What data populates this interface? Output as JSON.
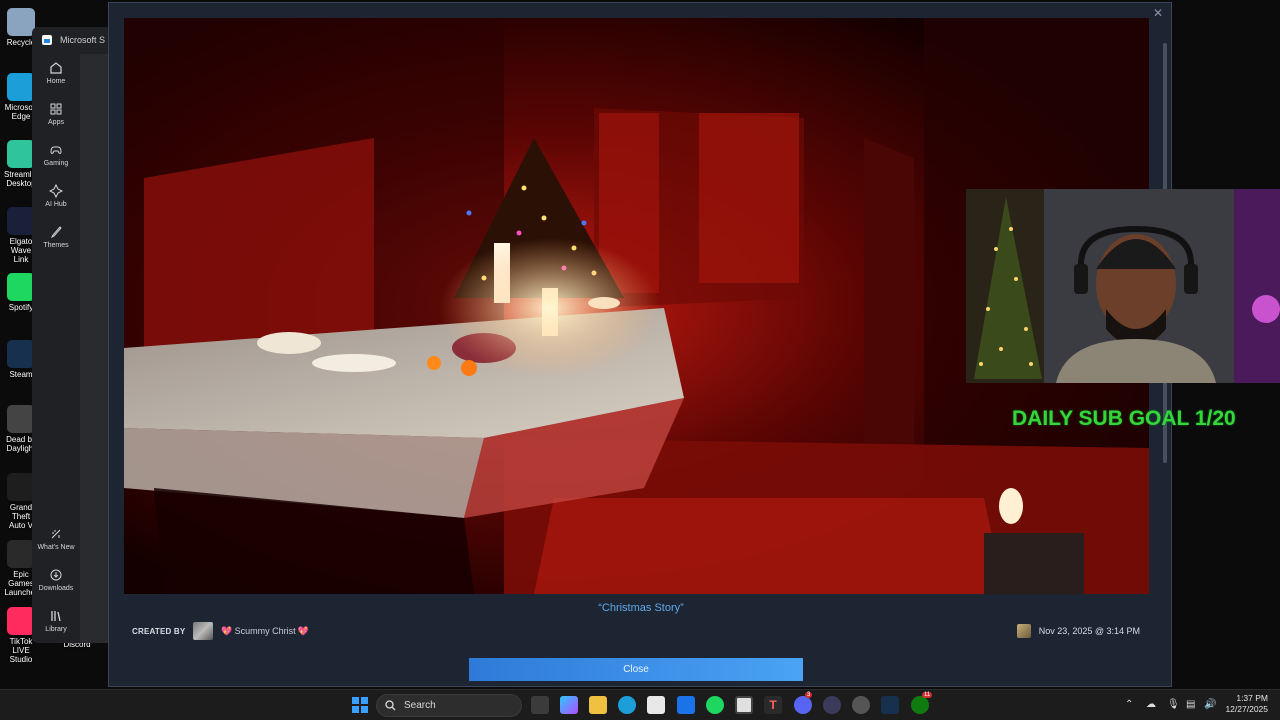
{
  "desktop": {
    "icons": [
      {
        "label": "Recycle",
        "color": "#8aa4c0"
      },
      {
        "label": "Microsoft Edge",
        "color": "#1c9fd9"
      },
      {
        "label": "Streamlabs Desktop",
        "color": "#2fc49a"
      },
      {
        "label": "Elgato Wave Link",
        "color": "#1a1f3a"
      },
      {
        "label": "Spotify",
        "color": "#1ed760"
      },
      {
        "label": "Steam",
        "color": "#16304d"
      },
      {
        "label": "Dead by Daylight",
        "color": "#444"
      },
      {
        "label": "Grand Theft Auto V",
        "color": "#1e1e1e"
      },
      {
        "label": "Epic Games Launcher",
        "color": "#2a2a2a"
      },
      {
        "label": "TikTok LIVE Studio",
        "color": "#ff2b5e"
      },
      {
        "label": "Discord",
        "color": "#1c1c1c"
      }
    ]
  },
  "store": {
    "title": "Microsoft S",
    "nav_top": [
      {
        "label": "Home",
        "icon": "home-icon"
      },
      {
        "label": "Apps",
        "icon": "apps-icon"
      },
      {
        "label": "Gaming",
        "icon": "gaming-icon"
      },
      {
        "label": "AI Hub",
        "icon": "ai-hub-icon"
      },
      {
        "label": "Themes",
        "icon": "themes-icon"
      }
    ],
    "nav_bottom": [
      {
        "label": "What's New",
        "icon": "whats-new-icon"
      },
      {
        "label": "Downloads",
        "icon": "downloads-icon"
      },
      {
        "label": "Library",
        "icon": "library-icon"
      }
    ]
  },
  "modal": {
    "caption": "“Christmas Story”",
    "created_by_label": "CREATED BY",
    "creator_name": "Scummy Christ",
    "creator_emoji": "💖",
    "date": "Nov 23, 2025 @ 3:14 PM",
    "close_label": "Close",
    "close_x": "✕"
  },
  "overlay": {
    "goal_text": "DAILY SUB GOAL 1/20",
    "goal_color": "#36d63a"
  },
  "taskbar": {
    "search_label": "Search",
    "time": "1:37 PM",
    "date": "12/27/2025",
    "badges": {
      "discord": "3",
      "xbox": "11"
    }
  }
}
